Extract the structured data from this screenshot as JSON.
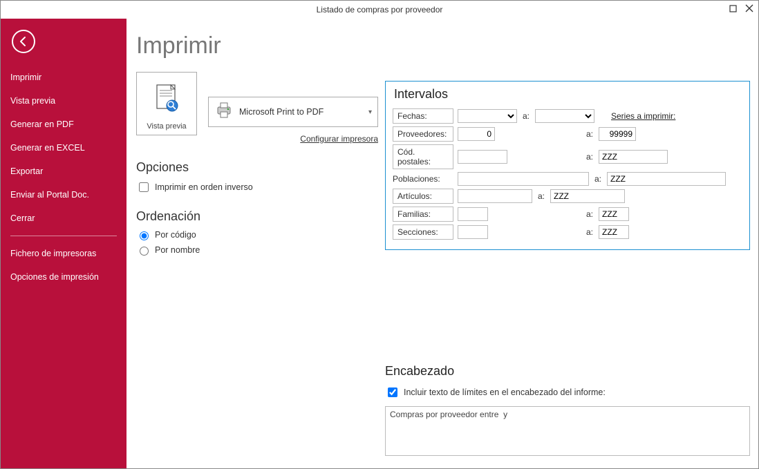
{
  "window": {
    "title": "Listado de compras por proveedor"
  },
  "sidebar": {
    "items": [
      {
        "label": "Imprimir"
      },
      {
        "label": "Vista previa"
      },
      {
        "label": "Generar en PDF"
      },
      {
        "label": "Generar en EXCEL"
      },
      {
        "label": "Exportar"
      },
      {
        "label": "Enviar al Portal Doc."
      },
      {
        "label": "Cerrar"
      }
    ],
    "items2": [
      {
        "label": "Fichero de impresoras"
      },
      {
        "label": "Opciones de impresión"
      }
    ]
  },
  "main": {
    "title": "Imprimir",
    "preview_label": "Vista previa",
    "printer_name": "Microsoft Print to PDF",
    "configure_link": "Configurar impresora"
  },
  "opciones": {
    "heading": "Opciones",
    "reverse_label": "Imprimir en orden inverso",
    "reverse_checked": false
  },
  "ordenacion": {
    "heading": "Ordenación",
    "por_codigo": "Por código",
    "por_nombre": "Por nombre",
    "selected": "codigo"
  },
  "intervalos": {
    "heading": "Intervalos",
    "fechas_label": "Fechas:",
    "fechas_from": "",
    "fechas_to": "",
    "a_sep": "a:",
    "series_link": "Series a imprimir:",
    "prov_label": "Proveedores:",
    "prov_from": "0",
    "prov_to": "99999",
    "cp_label": "Cód. postales:",
    "cp_from": "",
    "cp_to": "ZZZ",
    "pob_label": "Poblaciones:",
    "pob_from": "",
    "pob_to": "ZZZ",
    "art_label": "Artículos:",
    "art_from": "",
    "art_to": "ZZZ",
    "fam_label": "Familias:",
    "fam_from": "",
    "fam_to": "ZZZ",
    "sec_label": "Secciones:",
    "sec_from": "",
    "sec_to": "ZZZ"
  },
  "encabezado": {
    "heading": "Encabezado",
    "chk_label": "Incluir texto de límites en el encabezado del informe:",
    "chk_checked": true,
    "text": "Compras por proveedor entre  y"
  }
}
